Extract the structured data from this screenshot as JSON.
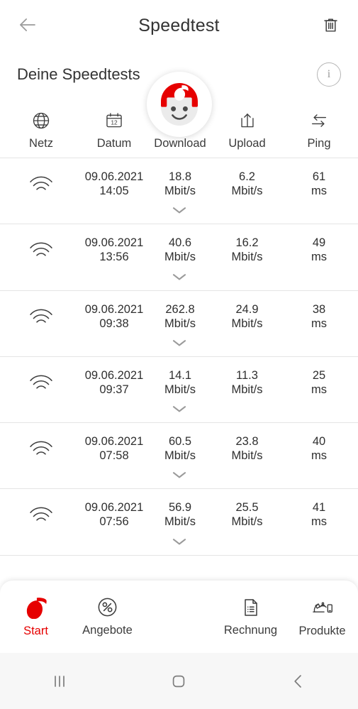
{
  "appbar": {
    "title": "Speedtest",
    "back_icon": "arrow-left-icon",
    "delete_icon": "trash-icon"
  },
  "section": {
    "title": "Deine Speedtests",
    "info_label": "i",
    "info_icon": "info-circle-icon"
  },
  "table": {
    "columns": [
      {
        "label": "Netz",
        "icon": "globe-icon"
      },
      {
        "label": "Datum",
        "icon": "calendar-icon"
      },
      {
        "label": "Download",
        "icon": "download-icon"
      },
      {
        "label": "Upload",
        "icon": "upload-icon"
      },
      {
        "label": "Ping",
        "icon": "swap-arrows-icon"
      }
    ],
    "calendar_day": "12",
    "expand_icon": "chevron-down-icon",
    "network_icon": "wifi-icon",
    "rows": [
      {
        "network": "wifi",
        "date": "09.06.2021",
        "time": "14:05",
        "download": "18.8",
        "download_unit": "Mbit/s",
        "upload": "6.2",
        "upload_unit": "Mbit/s",
        "ping": "61",
        "ping_unit": "ms"
      },
      {
        "network": "wifi",
        "date": "09.06.2021",
        "time": "13:56",
        "download": "40.6",
        "download_unit": "Mbit/s",
        "upload": "16.2",
        "upload_unit": "Mbit/s",
        "ping": "49",
        "ping_unit": "ms"
      },
      {
        "network": "wifi",
        "date": "09.06.2021",
        "time": "09:38",
        "download": "262.8",
        "download_unit": "Mbit/s",
        "upload": "24.9",
        "upload_unit": "Mbit/s",
        "ping": "38",
        "ping_unit": "ms"
      },
      {
        "network": "wifi",
        "date": "09.06.2021",
        "time": "09:37",
        "download": "14.1",
        "download_unit": "Mbit/s",
        "upload": "11.3",
        "upload_unit": "Mbit/s",
        "ping": "25",
        "ping_unit": "ms"
      },
      {
        "network": "wifi",
        "date": "09.06.2021",
        "time": "07:58",
        "download": "60.5",
        "download_unit": "Mbit/s",
        "upload": "23.8",
        "upload_unit": "Mbit/s",
        "ping": "40",
        "ping_unit": "ms"
      },
      {
        "network": "wifi",
        "date": "09.06.2021",
        "time": "07:56",
        "download": "56.9",
        "download_unit": "Mbit/s",
        "upload": "25.5",
        "upload_unit": "Mbit/s",
        "ping": "41",
        "ping_unit": "ms"
      }
    ]
  },
  "bottomnav": {
    "items": [
      {
        "label": "Start",
        "icon": "vodafone-logo-icon",
        "active": true
      },
      {
        "label": "Angebote",
        "icon": "percent-circle-icon",
        "active": false
      },
      {
        "label": "Rechnung",
        "icon": "document-list-icon",
        "active": false
      },
      {
        "label": "Produkte",
        "icon": "router-phone-icon",
        "active": false
      }
    ],
    "assistant_icon": "tobi-avatar-icon"
  },
  "sysnav": {
    "recents_icon": "recents-bars-icon",
    "home_icon": "home-square-icon",
    "back_icon": "back-chevron-icon"
  },
  "colors": {
    "vodafone_red": "#e60000",
    "text": "#2f2f2f",
    "icon_gray": "#3c3c3c",
    "divider": "#e4e4e4",
    "sysnav_bg": "#f7f7f7"
  }
}
